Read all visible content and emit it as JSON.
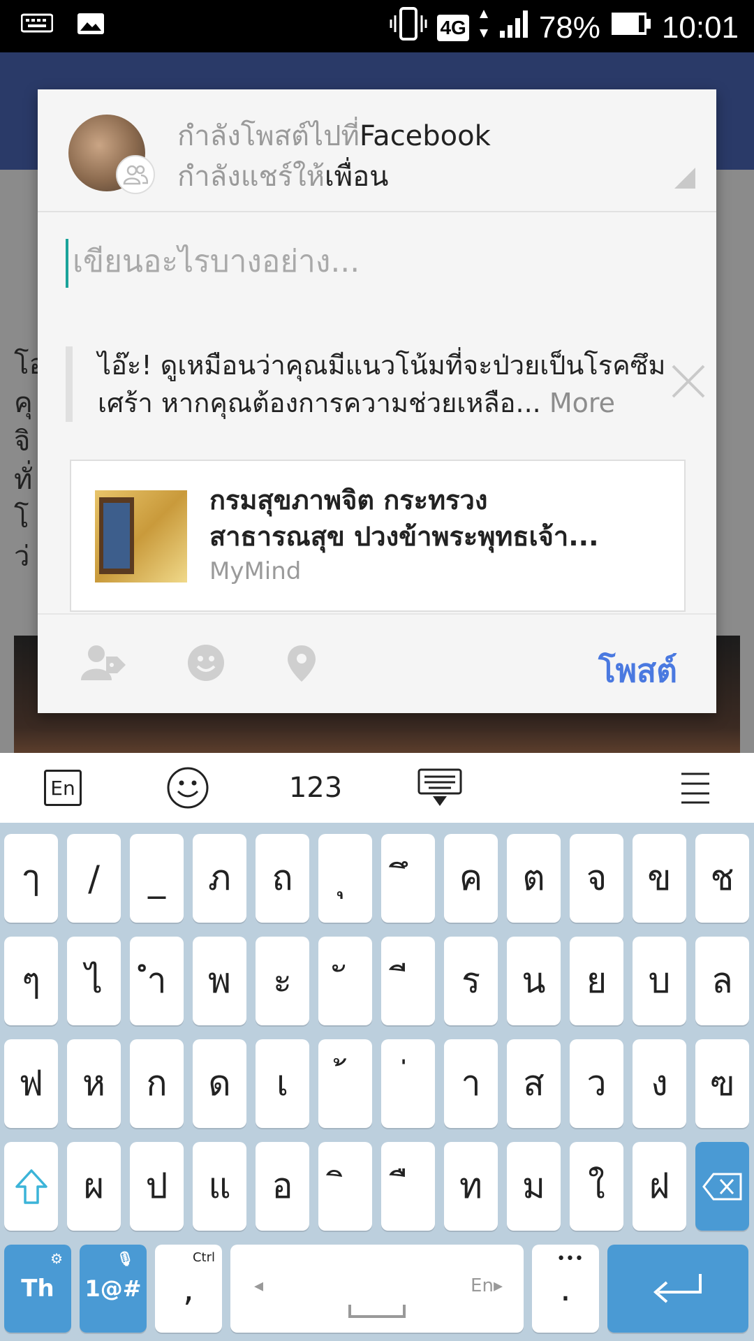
{
  "status_bar": {
    "battery": "78%",
    "time": "10:01",
    "network": "4G"
  },
  "composer": {
    "posting_to_prefix": "กำลังโพสต์ไปที่",
    "posting_to_target": "Facebook",
    "sharing_with_prefix": "กำลังแชร์ให้",
    "sharing_with_target": "เพื่อน",
    "placeholder": "เขียนอะไรบางอย่าง...",
    "suggestion_line1": "ไอ๊ะ! ดูเหมือนว่าคุณมีแนวโน้มที่จะป่วยเป็นโรคซึม",
    "suggestion_line2": "เศร้า หากคุณต้องการความช่วยเหลือ...",
    "suggestion_more": "More",
    "link_title": "กรมสุขภาพจิต กระทรวง\nสาธารณสุข ปวงข้าพระพุทธเจ้า...",
    "link_source": "MyMind",
    "post_button": "โพสต์"
  },
  "background_page": {
    "text_fragments": [
      "โอ",
      "คุ",
      "จิ",
      "ทั่",
      "โ",
      "ว่"
    ]
  },
  "keyboard": {
    "lang_toggle": "En",
    "num_toggle": "123",
    "row1": [
      "ๅ",
      "/",
      "_",
      "ภ",
      "ถ",
      "ุ",
      "ึ",
      "ค",
      "ต",
      "จ",
      "ข",
      "ช"
    ],
    "row2": [
      "ๆ",
      "ไ",
      "ำ",
      "พ",
      "ะ",
      "ั",
      "ี",
      "ร",
      "น",
      "ย",
      "บ",
      "ล"
    ],
    "row3": [
      "ฟ",
      "ห",
      "ก",
      "ด",
      "เ",
      "้",
      "่",
      "า",
      "ส",
      "ว",
      "ง",
      "ฃ"
    ],
    "row4": [
      "ผ",
      "ป",
      "แ",
      "อ",
      "ิ",
      "ื",
      "ท",
      "ม",
      "ใ",
      "ฝ"
    ],
    "lang_key": "Th",
    "symbols_key": "1@#",
    "ctrl_label": "Ctrl",
    "comma": ",",
    "space_lang": "En",
    "period": "."
  }
}
